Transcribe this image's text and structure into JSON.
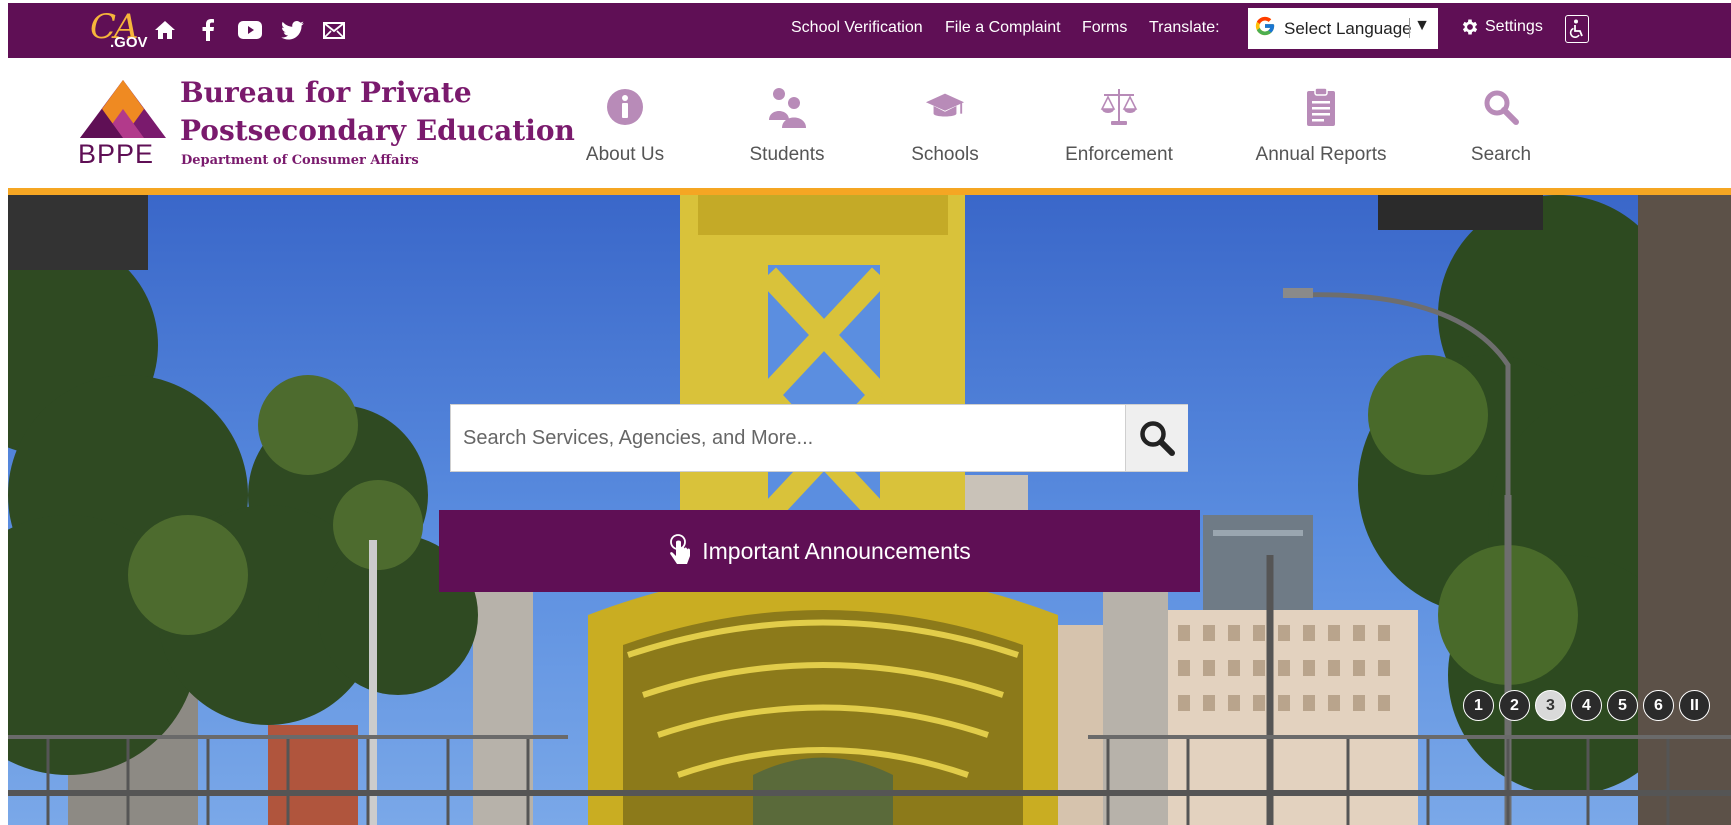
{
  "top_bar": {
    "cagov_logo_ca": "CA",
    "cagov_logo_gov": ".GOV",
    "social_icons": [
      "home-icon",
      "facebook-icon",
      "youtube-icon",
      "twitter-icon",
      "email-icon"
    ],
    "links": {
      "school_verification": "School Verification",
      "file_complaint": "File a Complaint",
      "forms": "Forms",
      "translate_label": "Translate:"
    },
    "language_select": {
      "selected": "Select Language",
      "g_logo": "G",
      "arrow": "▼"
    },
    "settings_label": "Settings",
    "accessibility_icon": "accessibility-icon"
  },
  "header": {
    "logo_text": "BPPE",
    "brand_line1": "Bureau for Private",
    "brand_line2": "Postsecondary Education",
    "brand_sub": "Department of Consumer Affairs",
    "nav": [
      {
        "label": "About Us",
        "icon": "info-icon"
      },
      {
        "label": "Students",
        "icon": "students-icon"
      },
      {
        "label": "Schools",
        "icon": "graduation-cap-icon"
      },
      {
        "label": "Enforcement",
        "icon": "scales-icon"
      },
      {
        "label": "Annual Reports",
        "icon": "clipboard-icon"
      },
      {
        "label": "Search",
        "icon": "search-icon"
      }
    ]
  },
  "hero": {
    "search_placeholder": "Search Services, Agencies, and More...",
    "announcements_label": "Important Announcements",
    "slides": [
      "1",
      "2",
      "3",
      "4",
      "5",
      "6"
    ],
    "active_slide": "3",
    "pause_label": "II"
  },
  "colors": {
    "brand_purple": "#5f0f55",
    "accent_orange": "#f5a623",
    "nav_icon_lilac": "#b88bb8",
    "cagov_gold": "#f6b53b"
  }
}
